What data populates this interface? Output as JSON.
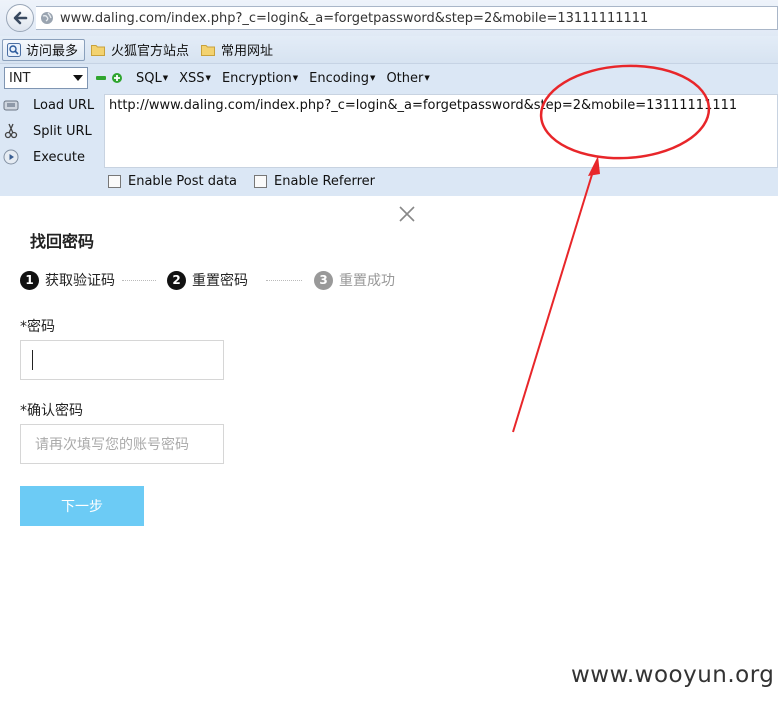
{
  "browser": {
    "url": "www.daling.com/index.php?_c=login&_a=forgetpassword&step=2&mobile=13111111111"
  },
  "bookmarks": [
    {
      "label": "访问最多",
      "icon": "most-visited-icon"
    },
    {
      "label": "火狐官方站点",
      "icon": "folder-icon"
    },
    {
      "label": "常用网址",
      "icon": "folder-icon"
    }
  ],
  "hackbar": {
    "type_select": "INT",
    "menus": [
      "SQL",
      "XSS",
      "Encryption",
      "Encoding",
      "Other"
    ],
    "actions": [
      "Load URL",
      "Split URL",
      "Execute"
    ],
    "url_value": "http://www.daling.com/index.php?_c=login&_a=forgetpassword&step=2&mobile=13111111111",
    "options": [
      "Enable Post data",
      "Enable Referrer"
    ]
  },
  "dialog": {
    "title": "找回密码",
    "steps": [
      {
        "num": "1",
        "label": "获取验证码",
        "state": "done"
      },
      {
        "num": "2",
        "label": "重置密码",
        "state": "current"
      },
      {
        "num": "3",
        "label": "重置成功",
        "state": "pending"
      }
    ],
    "password_label": "*密码",
    "password_value": "",
    "confirm_label": "*确认密码",
    "confirm_placeholder": "请再次填写您的账号密码",
    "next_label": "下一步"
  },
  "watermark": "www.wooyun.org",
  "colors": {
    "accent_button": "#6ccbf5",
    "annotation_red": "#e8262a",
    "step_active": "#111111",
    "step_pending": "#999999"
  }
}
